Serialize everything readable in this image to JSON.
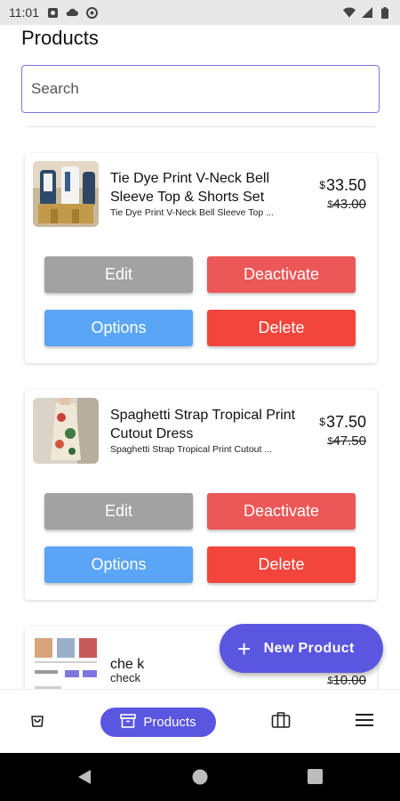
{
  "status_bar": {
    "time": "11:01"
  },
  "page": {
    "title": "Products"
  },
  "search": {
    "placeholder": "Search",
    "value": ""
  },
  "products": [
    {
      "name": "Tie Dye Print V-Neck Bell Sleeve Top & Shorts Set",
      "subtitle": "Tie Dye Print V-Neck Bell Sleeve Top ...",
      "currency": "$",
      "price": "33.50",
      "old_price": "43.00",
      "buttons": {
        "edit": "Edit",
        "deactivate": "Deactivate",
        "options": "Options",
        "delete": "Delete"
      }
    },
    {
      "name": "Spaghetti Strap Tropical Print Cutout Dress",
      "subtitle": "Spaghetti Strap Tropical Print Cutout ...",
      "currency": "$",
      "price": "37.50",
      "old_price": "47.50",
      "buttons": {
        "edit": "Edit",
        "deactivate": "Deactivate",
        "options": "Options",
        "delete": "Delete"
      }
    },
    {
      "name": "che k",
      "subtitle": "check",
      "currency": "$",
      "old_price": "10.00"
    }
  ],
  "fab": {
    "label": "New Product",
    "icon": "plus-icon"
  },
  "bottom_nav": {
    "items": [
      {
        "icon": "shopping-bag-icon"
      },
      {
        "icon": "archive-box-icon",
        "label": "Products",
        "active": true
      },
      {
        "icon": "briefcase-icon"
      },
      {
        "icon": "menu-icon"
      }
    ]
  },
  "colors": {
    "accent": "#5a56e0",
    "edit": "#a2a2a2",
    "deactivate": "#ec5757",
    "options": "#5aa5f5",
    "delete": "#f2453b"
  }
}
